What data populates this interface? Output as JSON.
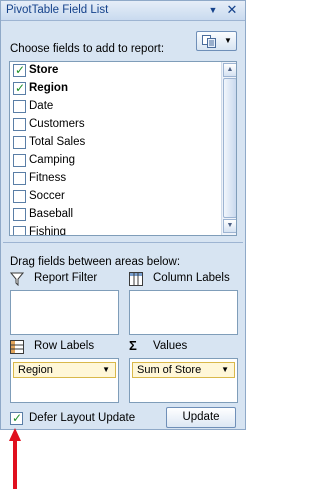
{
  "window": {
    "title": "PivotTable Field List",
    "dropdown_icon": "caret-down-icon",
    "close_icon": "close-icon"
  },
  "fields_section": {
    "label": "Choose fields to add to report:",
    "layout_button_icon": "field-list-layout-icon",
    "fields": [
      {
        "label": "Store",
        "checked": true
      },
      {
        "label": "Region",
        "checked": true
      },
      {
        "label": "Date",
        "checked": false
      },
      {
        "label": "Customers",
        "checked": false
      },
      {
        "label": "Total Sales",
        "checked": false
      },
      {
        "label": "Camping",
        "checked": false
      },
      {
        "label": "Fitness",
        "checked": false
      },
      {
        "label": "Soccer",
        "checked": false
      },
      {
        "label": "Baseball",
        "checked": false
      },
      {
        "label": "Fishing",
        "checked": false
      }
    ]
  },
  "areas_section": {
    "label": "Drag fields between areas below:",
    "report_filter": {
      "title": "Report Filter",
      "icon": "filter-icon"
    },
    "column_labels": {
      "title": "Column Labels",
      "icon": "column-labels-icon"
    },
    "row_labels": {
      "title": "Row Labels",
      "icon": "row-labels-icon",
      "item": "Region"
    },
    "values": {
      "title": "Values",
      "icon": "sigma-icon",
      "symbol": "Σ",
      "item": "Sum of Store"
    }
  },
  "footer": {
    "defer_label": "Defer Layout Update",
    "defer_checked": true,
    "update_label": "Update"
  },
  "colors": {
    "panel_bg": "#d7e4f2",
    "title_text": "#15428b",
    "check_green": "#20902a",
    "pill_bg": "#fff7d8",
    "annotation_arrow": "#e0101e"
  }
}
